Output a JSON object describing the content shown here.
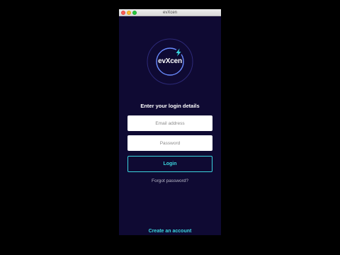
{
  "window": {
    "title": "evXcen"
  },
  "logo": {
    "text": "evXcen",
    "icon": "bolt-icon"
  },
  "form": {
    "heading": "Enter your login details",
    "email_placeholder": "Email address",
    "password_placeholder": "Password",
    "login_label": "Login",
    "forgot_label": "Forgot password?"
  },
  "footer": {
    "create_account_label": "Create an account"
  },
  "colors": {
    "background": "#0f0a33",
    "accent": "#3ad5df",
    "ring_inner": "#5b7bff",
    "ring_outer": "#2d2a78"
  }
}
